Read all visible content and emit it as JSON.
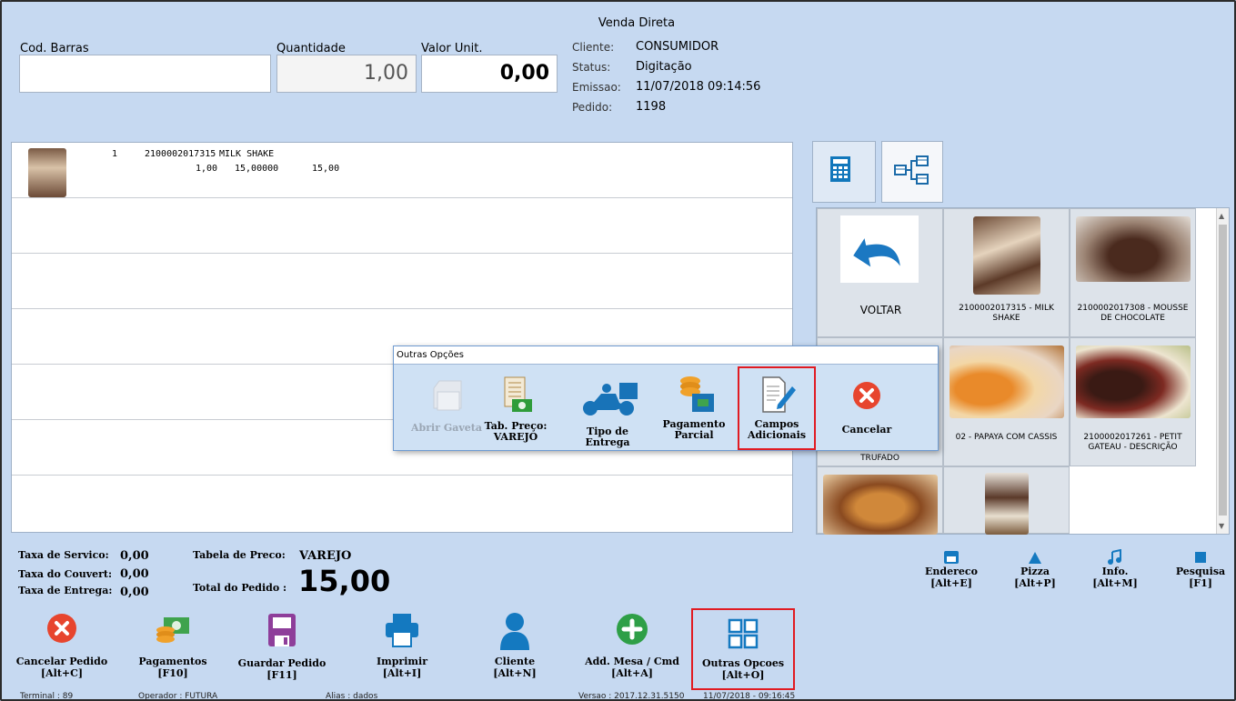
{
  "window": {
    "title": "Venda Direta"
  },
  "header": {
    "barcode_label": "Cod. Barras",
    "barcode_value": "",
    "qty_label": "Quantidade",
    "qty_value": "1,00",
    "unit_label": "Valor Unit.",
    "unit_value": "0,00",
    "info": [
      {
        "key": "Cliente:",
        "value": "CONSUMIDOR"
      },
      {
        "key": "Status:",
        "value": "Digitação"
      },
      {
        "key": "Emissao:",
        "value": "11/07/2018 09:14:56"
      },
      {
        "key": "Pedido:",
        "value": "1198"
      }
    ]
  },
  "items": [
    {
      "seq": "1",
      "code": "2100002017315",
      "name": "MILK SHAKE",
      "qty": "1,00",
      "price": "15,00000",
      "total": "15,00"
    }
  ],
  "tabs": [
    {
      "name": "calculator-tab",
      "icon": "calculator-icon"
    },
    {
      "name": "tree-tab",
      "icon": "tree-icon"
    }
  ],
  "products": {
    "voltar": "VOLTAR",
    "p1": "2100002017315 - MILK SHAKE",
    "p2": "2100002017308 - MOUSSE DE CHOCOLATE",
    "p3": "TRUFADO",
    "p4": "02 - PAPAYA COM CASSIS",
    "p5": "2100002017261 - PETIT GATEAU - DESCRIÇÃO"
  },
  "popup": {
    "title": "Outras Opções",
    "buttons": [
      {
        "label": "Abrir Gaveta",
        "icon": "drawer-icon",
        "disabled": true
      },
      {
        "label": "Tab. Preço: VAREJO",
        "icon": "price-table-icon"
      },
      {
        "label": "Tipo de Entrega",
        "icon": "motorcycle-icon"
      },
      {
        "label": "Pagamento Parcial",
        "icon": "partial-payment-icon"
      },
      {
        "label": "Campos Adicionais",
        "icon": "edit-document-icon",
        "highlighted": true
      },
      {
        "label": "Cancelar",
        "icon": "cancel-icon"
      }
    ]
  },
  "totals": {
    "servico_label": "Taxa de Servico:",
    "servico": "0,00",
    "couvert_label": "Taxa do Couvert:",
    "couvert": "0,00",
    "entrega_label": "Taxa de Entrega:",
    "entrega": "0,00",
    "tabela_label": "Tabela de Preco:",
    "tabela": "VAREJO",
    "total_label": "Total do Pedido :",
    "total": "15,00"
  },
  "shortcuts": [
    {
      "label": "Endereco",
      "key": "[Alt+E]",
      "icon": "store-icon"
    },
    {
      "label": "Pizza",
      "key": "[Alt+P]",
      "icon": "triangle-icon"
    },
    {
      "label": "Info.",
      "key": "[Alt+M]",
      "icon": "music-note-icon"
    },
    {
      "label": "Pesquisa",
      "key": "[F1]",
      "icon": "square-icon"
    }
  ],
  "actions": [
    {
      "label": "Cancelar Pedido",
      "key": "[Alt+C]",
      "icon": "cancel-icon"
    },
    {
      "label": "Pagamentos",
      "key": "[F10]",
      "icon": "money-icon"
    },
    {
      "label": "Guardar Pedido",
      "key": "[F11]",
      "icon": "save-icon"
    },
    {
      "label": "Imprimir",
      "key": "[Alt+I]",
      "icon": "printer-icon"
    },
    {
      "label": "Cliente",
      "key": "[Alt+N]",
      "icon": "user-icon"
    },
    {
      "label": "Add. Mesa / Cmd",
      "key": "[Alt+A]",
      "icon": "add-icon"
    },
    {
      "label": "Outras Opcoes",
      "key": "[Alt+O]",
      "icon": "grid-icon",
      "highlighted": true
    }
  ],
  "status": {
    "terminal": "Terminal : 89",
    "operador": "Operador : FUTURA",
    "alias": "Alias : dados",
    "versao": "Versao : 2017.12.31.5150",
    "datetime": "11/07/2018 - 09:16:45"
  },
  "colors": {
    "accent": "#0f7bc4",
    "highlight": "#e11b22",
    "background": "#c6d9f1"
  }
}
